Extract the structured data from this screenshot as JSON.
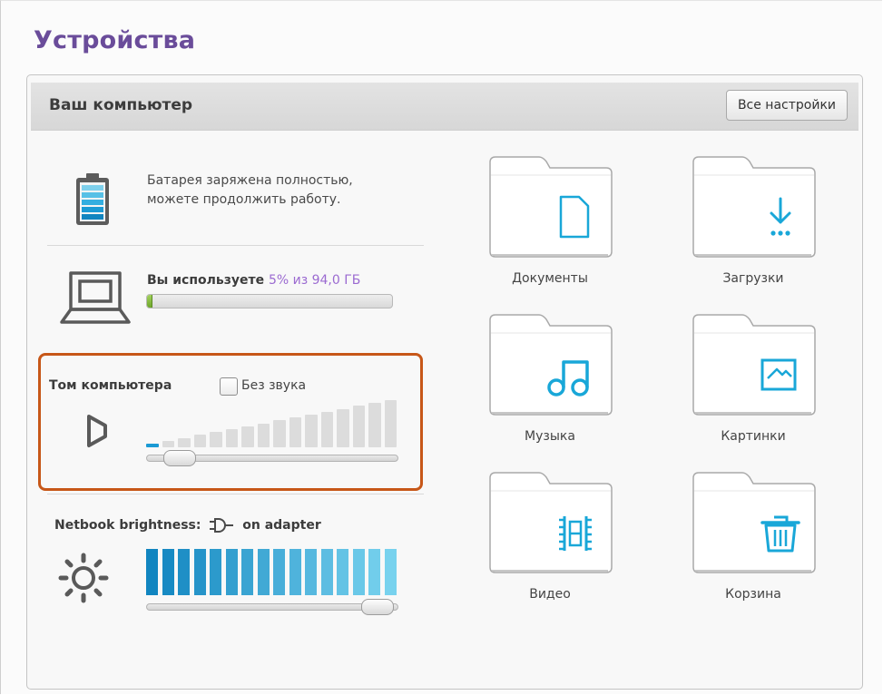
{
  "page": {
    "title": "Устройства"
  },
  "panel": {
    "title": "Ваш компьютер",
    "all_settings_label": "Все настройки"
  },
  "battery": {
    "line1": "Батарея заряжена полностью,",
    "line2": "можете продолжить работу.",
    "icon": "battery-full-icon"
  },
  "storage": {
    "prefix": "Вы используете",
    "usage": "5% из 94,0 ГБ",
    "used_fraction": 0.02,
    "icon": "laptop-icon"
  },
  "volume": {
    "label": "Том компьютера",
    "mute_label": "Без звука",
    "muted": false,
    "level_fraction": 0.08,
    "levels": 16,
    "icon": "speaker-icon"
  },
  "brightness": {
    "label": "Netbook brightness:",
    "source": "on adapter",
    "level_fraction": 0.98,
    "levels": 16,
    "icon": "sun-icon"
  },
  "folders": [
    {
      "label": "Документы",
      "icon": "document-icon"
    },
    {
      "label": "Загрузки",
      "icon": "download-icon"
    },
    {
      "label": "Музыка",
      "icon": "music-icon"
    },
    {
      "label": "Картинки",
      "icon": "picture-icon"
    },
    {
      "label": "Видео",
      "icon": "video-icon"
    },
    {
      "label": "Корзина",
      "icon": "trash-icon"
    }
  ],
  "colors": {
    "title": "#6a4c9a",
    "accent_blue": "#19a7d8",
    "highlight_border": "#c75718",
    "storage_fill": "#7cb432"
  }
}
